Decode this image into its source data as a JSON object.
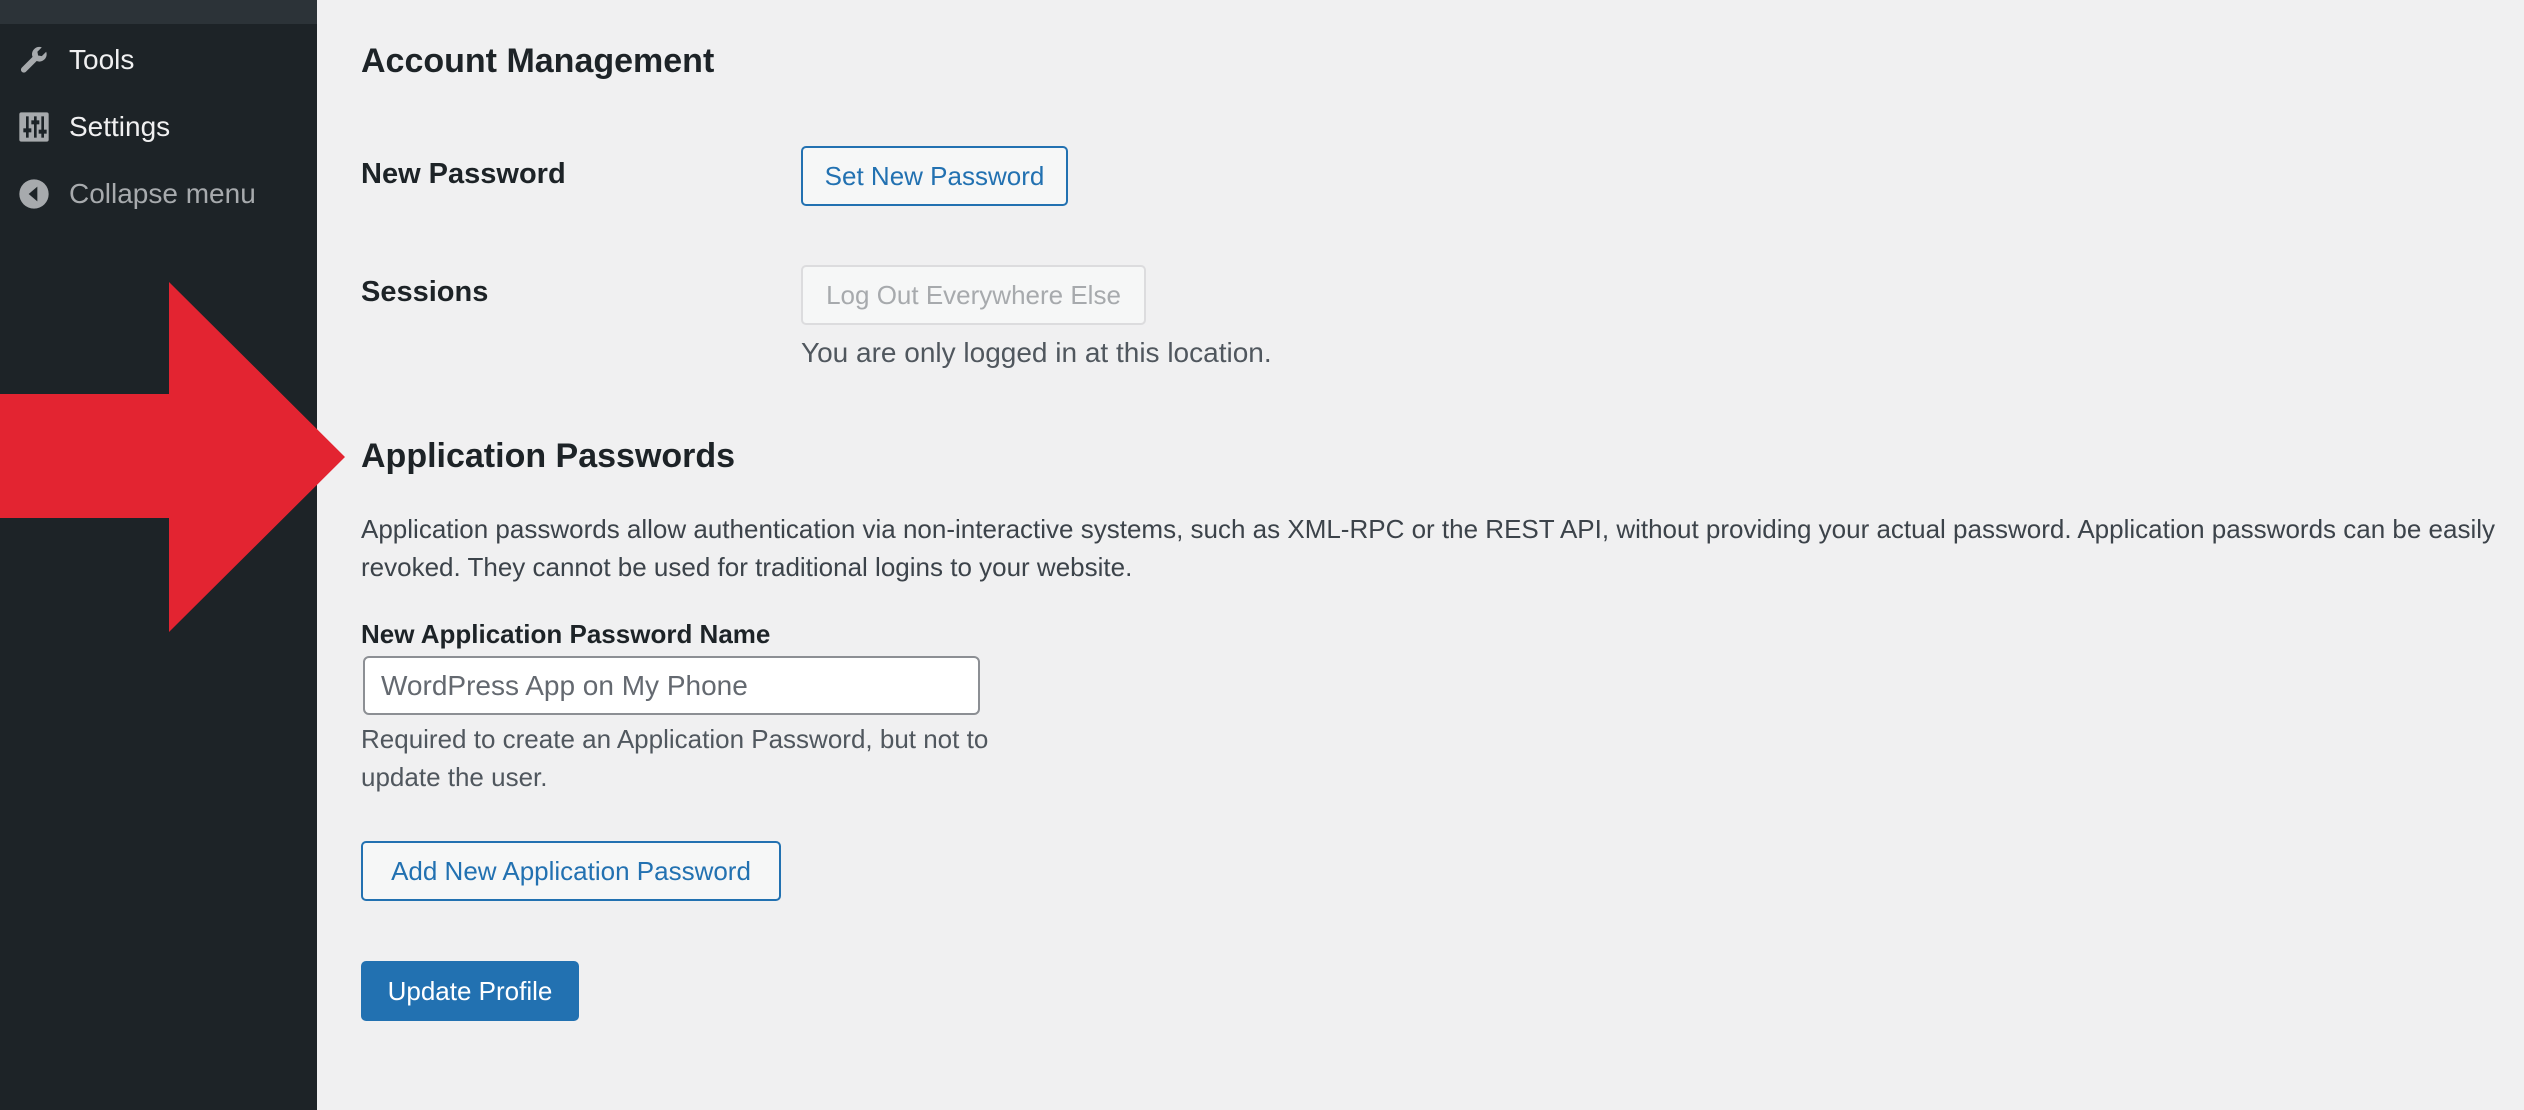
{
  "sidebar": {
    "items": [
      {
        "label": "Tools",
        "icon": "wrench-icon"
      },
      {
        "label": "Settings",
        "icon": "sliders-icon"
      },
      {
        "label": "Collapse menu",
        "icon": "collapse-arrow-icon"
      }
    ]
  },
  "account_management": {
    "heading": "Account Management",
    "new_password": {
      "label": "New Password",
      "button": "Set New Password"
    },
    "sessions": {
      "label": "Sessions",
      "button": "Log Out Everywhere Else",
      "description": "You are only logged in at this location."
    }
  },
  "application_passwords": {
    "heading": "Application Passwords",
    "description": "Application passwords allow authentication via non-interactive systems, such as XML-RPC or the REST API, without providing your actual password. Application passwords can be easily revoked. They cannot be used for traditional logins to your website.",
    "field_label": "New Application Password Name",
    "placeholder": "WordPress App on My Phone",
    "value": "",
    "help": "Required to create an Application Password, but not to update the user.",
    "add_button": "Add New Application Password"
  },
  "update_button": "Update Profile",
  "colors": {
    "sidebar_bg": "#1d2327",
    "content_bg": "#f0f0f1",
    "accent": "#2271b1",
    "arrow": "#e32431"
  }
}
